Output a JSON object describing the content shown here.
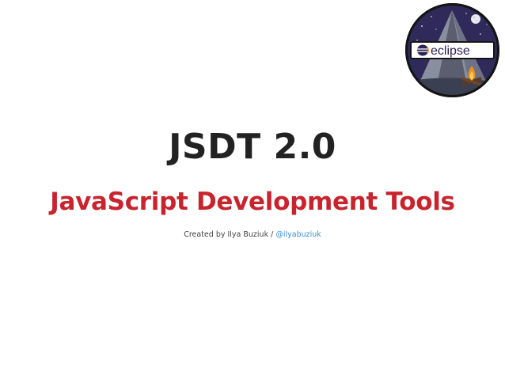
{
  "slide": {
    "title": "JSDT 2.0",
    "subtitle": "JavaScript Development Tools",
    "credit": {
      "text": "Created by Ilya Buziuk /",
      "link": "@ilyabuziuk"
    }
  },
  "logo": {
    "text": "eclipse",
    "icon": "eclipse-badge-icon"
  },
  "colors": {
    "title": "#222222",
    "subtitle": "#c8242e",
    "link": "#3a8fd6",
    "logo_bg": "#2f2a5a"
  }
}
